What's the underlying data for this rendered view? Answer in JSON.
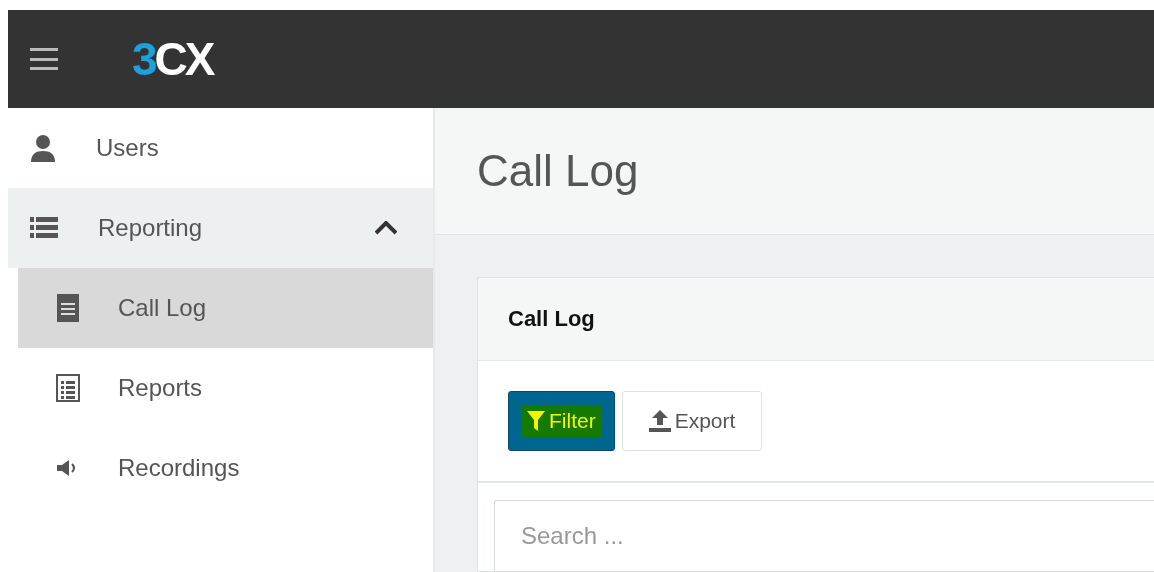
{
  "top_bar": {
    "logo": [
      {
        "text": "3",
        "color": "#1ba1dc"
      },
      {
        "text": "CX",
        "color": "#ffffff"
      }
    ]
  },
  "sidebar": {
    "items": [
      {
        "label": "Users",
        "selected": false
      },
      {
        "label": "Reporting",
        "selected": false,
        "expanded": true,
        "children": [
          {
            "label": "Call Log",
            "selected": true
          },
          {
            "label": "Reports",
            "selected": false
          },
          {
            "label": "Recordings",
            "selected": false
          }
        ]
      }
    ]
  },
  "page_title": "Call Log",
  "panel": {
    "title": "Call Log",
    "buttons": [
      {
        "label": "Filter",
        "kind": "primary",
        "highlighted": true
      },
      {
        "label": "Export",
        "kind": "default",
        "highlighted": false
      }
    ],
    "search": {
      "placeholder": "Search ..."
    }
  }
}
